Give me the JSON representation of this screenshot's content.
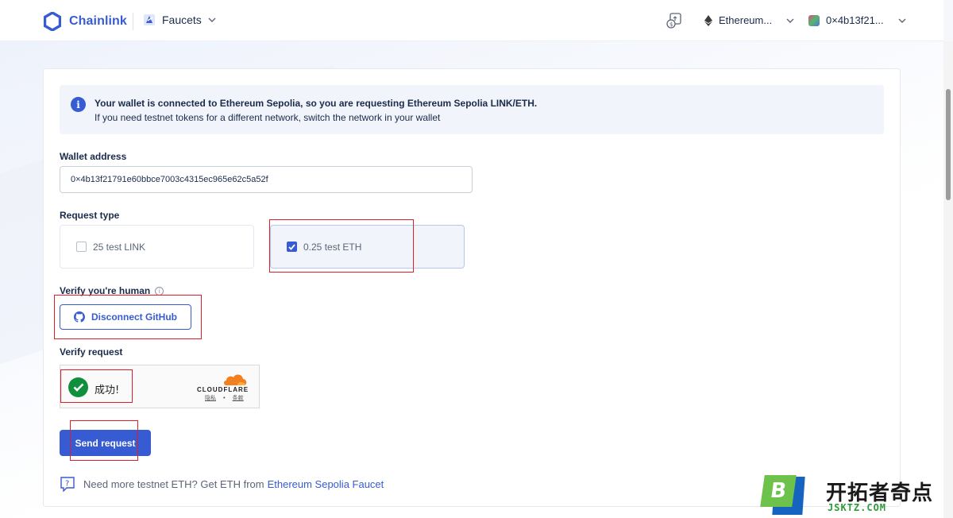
{
  "header": {
    "brand": "Chainlink",
    "product": "Faucets",
    "network": "Ethereum...",
    "account": "0×4b13f21..."
  },
  "info": {
    "line1": "Your wallet is connected to Ethereum Sepolia, so you are requesting Ethereum Sepolia LINK/ETH.",
    "line2": "If you need testnet tokens for a different network, switch the network in your wallet",
    "icon": "i"
  },
  "form": {
    "wallet_label": "Wallet address",
    "wallet_value": "0×4b13f21791e60bbce7003c4315ec965e62c5a52f",
    "request_type_label": "Request type",
    "options": [
      {
        "label": "25 test LINK",
        "checked": false
      },
      {
        "label": "0.25 test ETH",
        "checked": true
      }
    ],
    "verify_human_label": "Verify you're human",
    "github_button": "Disconnect GitHub",
    "verify_request_label": "Verify request",
    "captcha": {
      "status": "成功!",
      "brand": "CLOUDFLARE",
      "privacy": "隐私",
      "separator": "•",
      "terms": "条款"
    },
    "send_button": "Send request"
  },
  "footer": {
    "text": "Need more testnet ETH? Get ETH from",
    "link": "Ethereum Sepolia Faucet"
  },
  "watermark": {
    "letter": "B",
    "cn": "开拓者奇点",
    "en": "JSKTZ.COM"
  },
  "colors": {
    "accent": "#375bd2",
    "success": "#108f3c",
    "annotation": "#e01e2a"
  }
}
